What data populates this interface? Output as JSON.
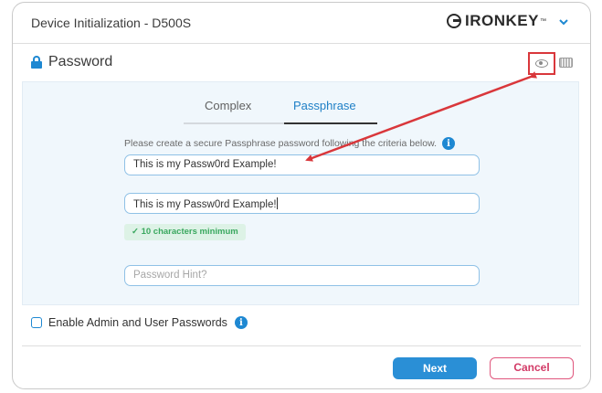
{
  "window": {
    "title": "Device Initialization - D500S",
    "brand": "IRONKEY",
    "brand_tm": "™",
    "brand_menu_icon": "chevron-down-icon"
  },
  "section": {
    "title": "Password",
    "icon": "lock-icon",
    "show_password_icon": "eye-icon",
    "keyboard_icon": "keyboard-icon"
  },
  "tabs": [
    {
      "label": "Complex",
      "active": false
    },
    {
      "label": "Passphrase",
      "active": true
    }
  ],
  "form": {
    "criteria_text": "Please create a secure Passphrase password following the criteria below.",
    "password_value": "This is my Passw0rd Example!",
    "confirm_value": "This is my Passw0rd Example!",
    "requirement_badge": "✓ 10 characters minimum",
    "hint_placeholder": "Password Hint?"
  },
  "options": {
    "admin_user_label": "Enable Admin and User Passwords",
    "admin_user_checked": false
  },
  "buttons": {
    "next": "Next",
    "cancel": "Cancel"
  },
  "colors": {
    "accent": "#1e88d2",
    "success": "#3aa85f",
    "cancel": "#d23a66",
    "annotation": "#d9373b"
  }
}
